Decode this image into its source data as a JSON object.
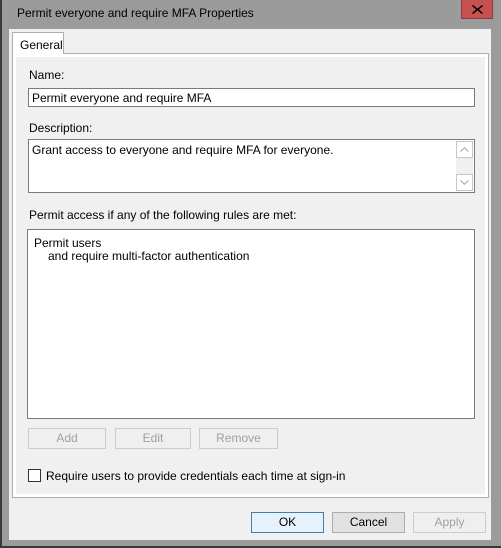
{
  "window": {
    "title": "Permit everyone and require MFA Properties",
    "close_icon": "close-icon",
    "accent_close": "#c75050"
  },
  "tabs": [
    {
      "label": "General",
      "selected": true
    }
  ],
  "general": {
    "name_label": "Name:",
    "name_value": "Permit everyone and require MFA",
    "description_label": "Description:",
    "description_value": "Grant access to everyone and require MFA for everyone.",
    "rules_label": "Permit access if any of the following rules are met:",
    "rules": [
      "Permit users",
      "and require multi-factor authentication"
    ],
    "buttons": {
      "add": "Add",
      "edit": "Edit",
      "remove": "Remove"
    },
    "checkbox": {
      "label": "Require users to provide credentials each time at sign-in",
      "checked": false
    }
  },
  "footer": {
    "ok": "OK",
    "cancel": "Cancel",
    "apply": "Apply"
  }
}
